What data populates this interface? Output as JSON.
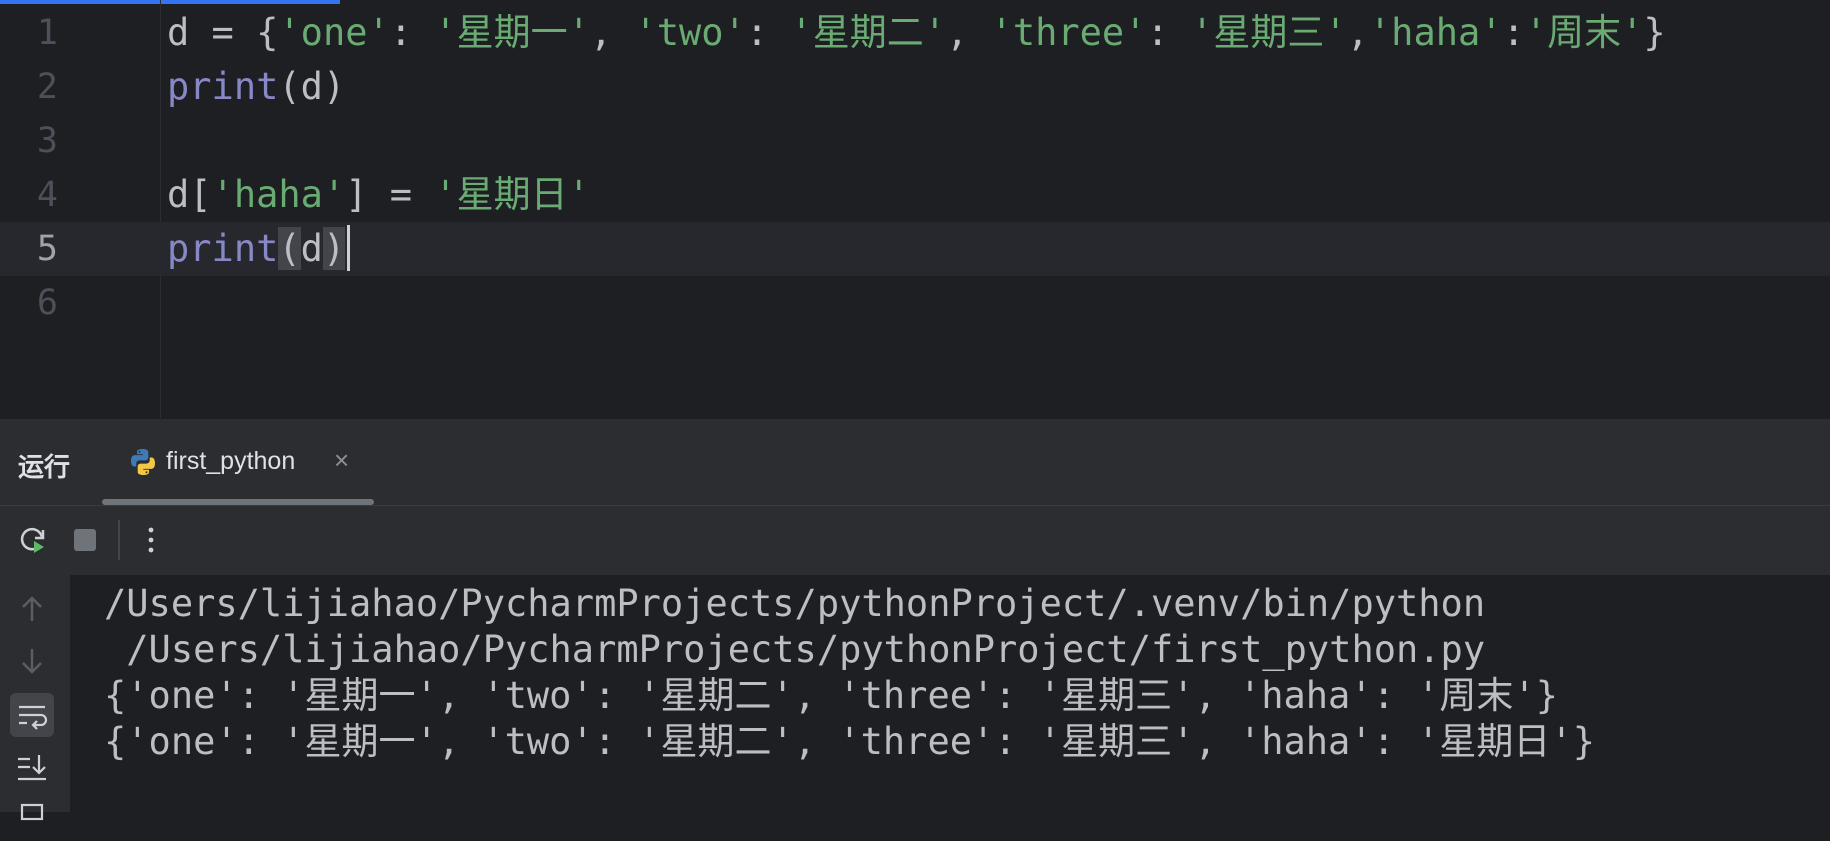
{
  "editor": {
    "lines": [
      {
        "number": "1",
        "tokens": [
          {
            "t": "d = {",
            "c": "plain"
          },
          {
            "t": "'one'",
            "c": "str"
          },
          {
            "t": ": ",
            "c": "plain"
          },
          {
            "t": "'星期一'",
            "c": "str"
          },
          {
            "t": ", ",
            "c": "plain"
          },
          {
            "t": "'two'",
            "c": "str"
          },
          {
            "t": ": ",
            "c": "plain"
          },
          {
            "t": "'星期二'",
            "c": "str"
          },
          {
            "t": ", ",
            "c": "plain"
          },
          {
            "t": "'three'",
            "c": "str"
          },
          {
            "t": ": ",
            "c": "plain"
          },
          {
            "t": "'星期三'",
            "c": "str"
          },
          {
            "t": ",",
            "c": "plain"
          },
          {
            "t": "'haha'",
            "c": "str"
          },
          {
            "t": ":",
            "c": "plain"
          },
          {
            "t": "'周末'",
            "c": "str"
          },
          {
            "t": "}",
            "c": "plain"
          }
        ]
      },
      {
        "number": "2",
        "tokens": [
          {
            "t": "print",
            "c": "kw"
          },
          {
            "t": "(d)",
            "c": "plain"
          }
        ]
      },
      {
        "number": "3",
        "tokens": []
      },
      {
        "number": "4",
        "tokens": [
          {
            "t": "d[",
            "c": "plain"
          },
          {
            "t": "'haha'",
            "c": "str"
          },
          {
            "t": "] = ",
            "c": "plain"
          },
          {
            "t": "'星期日'",
            "c": "str"
          }
        ]
      },
      {
        "number": "5",
        "current": true,
        "caret": true,
        "tokens": [
          {
            "t": "print",
            "c": "kw"
          },
          {
            "t": "(",
            "c": "plain hl"
          },
          {
            "t": "d",
            "c": "plain"
          },
          {
            "t": ")",
            "c": "plain hl"
          }
        ]
      },
      {
        "number": "6",
        "tokens": []
      }
    ]
  },
  "run_panel": {
    "title": "运行",
    "tab_label": "first_python",
    "tab_close": "×"
  },
  "console": {
    "lines": [
      "/Users/lijiahao/PycharmProjects/pythonProject/.venv/bin/python",
      " /Users/lijiahao/PycharmProjects/pythonProject/first_python.py",
      "{'one': '星期一', 'two': '星期二', 'three': '星期三', 'haha': '周末'}",
      "{'one': '星期一', 'two': '星期二', 'three': '星期三', 'haha': '星期日'}"
    ]
  },
  "colors": {
    "keyword": "#8888c6",
    "string": "#6aab73",
    "text": "#bcbec4",
    "background": "#1e1f22",
    "panel": "#2b2d30",
    "accent": "#3574f0"
  },
  "icons": {
    "toolbar": [
      "rerun-icon",
      "stop-icon",
      "more-options-icon"
    ],
    "side": [
      "scroll-up-icon",
      "scroll-down-icon",
      "soft-wrap-icon",
      "scroll-to-end-icon"
    ]
  }
}
